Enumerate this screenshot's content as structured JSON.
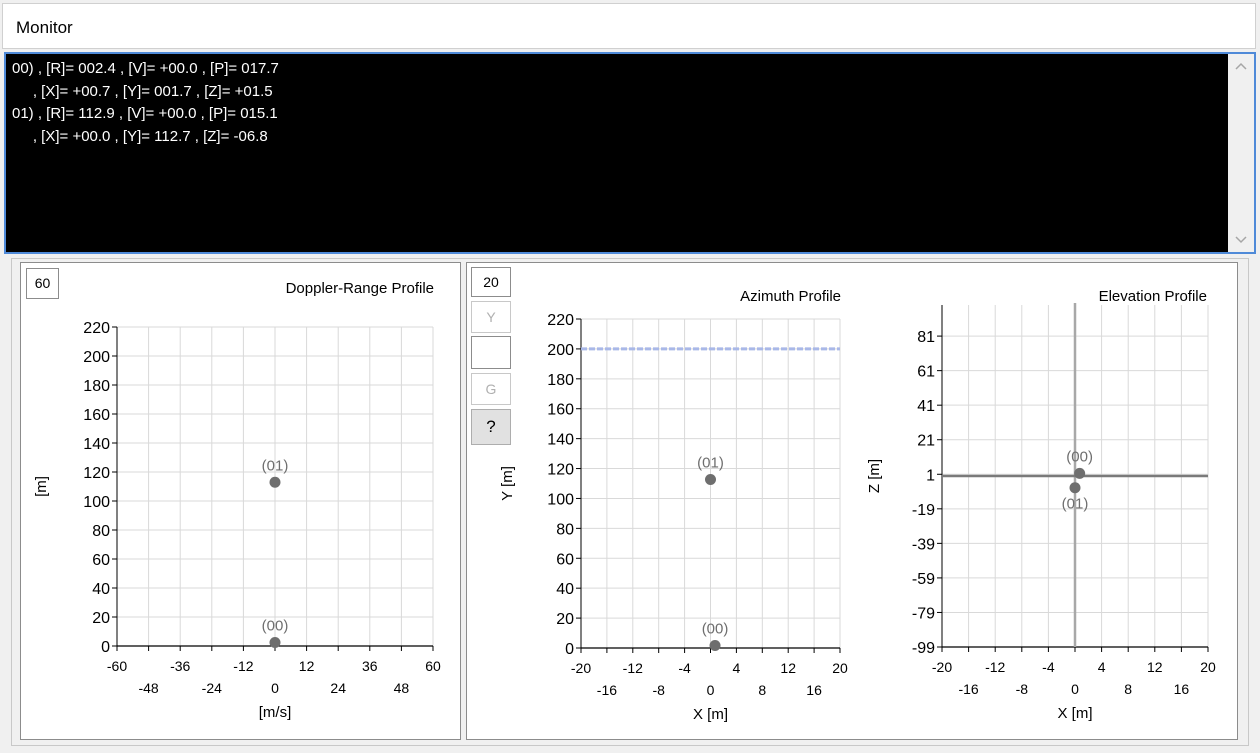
{
  "window": {
    "title": "Monitor"
  },
  "console": {
    "lines": [
      "00) , [R]= 002.4 , [V]= +00.0 , [P]= 017.7",
      "     , [X]= +00.7 , [Y]= 001.7 , [Z]= +01.5",
      "01) , [R]= 112.9 , [V]= +00.0 , [P]= 015.1",
      "     , [X]= +00.0 , [Y]= 112.7 , [Z]= -06.8"
    ]
  },
  "colors": {
    "console_bg": "#000000",
    "console_border": "#4f8ad8",
    "point": "#6e6e6e",
    "grid": "#d9d9d9",
    "threshold_line": "#a9b8e8"
  },
  "controls": {
    "doppler_box_value": "60",
    "azimuth_box_value": "20",
    "y_button": "Y",
    "blank_field": "",
    "g_button": "G",
    "help_button": "?"
  },
  "icons": {
    "scroll_up": "chevron-up-icon",
    "scroll_down": "chevron-down-icon"
  },
  "chart_data": [
    {
      "type": "scatter",
      "title": "Doppler-Range Profile",
      "xlabel": "[m/s]",
      "ylabel": "[m]",
      "xlim": [
        -60,
        60
      ],
      "ylim": [
        0,
        220
      ],
      "x_ticks_top": [
        "-60",
        "-36",
        "-12",
        "12",
        "36",
        "60"
      ],
      "x_ticks_bottom": [
        "-48",
        "-24",
        "0",
        "24",
        "48"
      ],
      "y_ticks": [
        "0",
        "20",
        "40",
        "60",
        "80",
        "100",
        "120",
        "140",
        "160",
        "180",
        "200",
        "220"
      ],
      "points": [
        {
          "label": "(00)",
          "x": 0,
          "y": 2.4
        },
        {
          "label": "(01)",
          "x": 0,
          "y": 112.9
        }
      ],
      "grid": true
    },
    {
      "type": "scatter",
      "title": "Azimuth Profile",
      "xlabel": "X [m]",
      "ylabel": "Y [m]",
      "xlim": [
        -20,
        20
      ],
      "ylim": [
        0,
        220
      ],
      "x_ticks_top": [
        "-20",
        "-12",
        "-4",
        "4",
        "12",
        "20"
      ],
      "x_ticks_bottom": [
        "-16",
        "-8",
        "0",
        "8",
        "16"
      ],
      "y_ticks": [
        "0",
        "20",
        "40",
        "60",
        "80",
        "100",
        "120",
        "140",
        "160",
        "180",
        "200",
        "220"
      ],
      "threshold_y": 200,
      "points": [
        {
          "label": "(00)",
          "x": 0.7,
          "y": 1.7
        },
        {
          "label": "(01)",
          "x": 0.0,
          "y": 112.7
        }
      ],
      "grid": true
    },
    {
      "type": "scatter",
      "title": "Elevation Profile",
      "xlabel": "X [m]",
      "ylabel": "Z [m]",
      "xlim": [
        -20,
        20
      ],
      "ylim": [
        -99,
        99
      ],
      "x_ticks_top": [
        "-20",
        "-12",
        "-4",
        "4",
        "12",
        "20"
      ],
      "x_ticks_bottom": [
        "-16",
        "-8",
        "0",
        "8",
        "16"
      ],
      "y_ticks": [
        "-99",
        "-79",
        "-59",
        "-39",
        "-19",
        "1",
        "21",
        "41",
        "61",
        "81"
      ],
      "points": [
        {
          "label": "(00)",
          "x": 0.7,
          "y": 1.5
        },
        {
          "label": "(01)",
          "x": 0.0,
          "y": -6.8
        }
      ],
      "grid": true
    }
  ]
}
